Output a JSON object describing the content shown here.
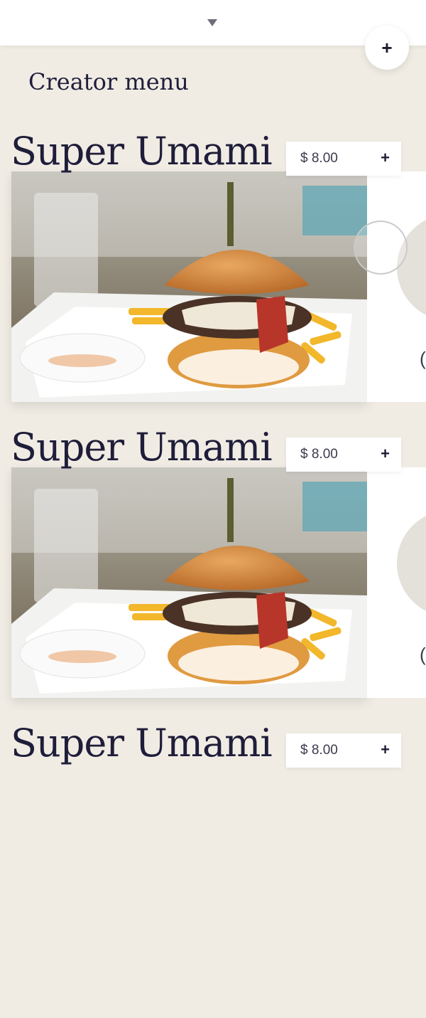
{
  "header": {
    "collapse_icon": "chevron-down-icon",
    "add_icon": "plus-icon",
    "add_label": "+"
  },
  "menu_title": "Creator menu",
  "colors": {
    "background": "#f0ece4",
    "text": "#1f1d3a",
    "card": "#ffffff"
  },
  "items": [
    {
      "title": "Super Umami",
      "price": "$ 8.00",
      "add_label": "+",
      "side_char": "("
    },
    {
      "title": "Super Umami",
      "price": "$ 8.00",
      "add_label": "+",
      "side_char": "("
    },
    {
      "title": "Super Umami",
      "price": "$ 8.00",
      "add_label": "+"
    }
  ]
}
